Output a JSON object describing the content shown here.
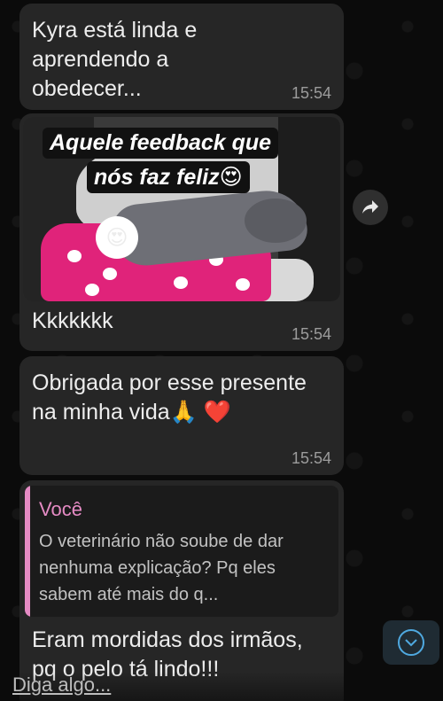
{
  "messages": [
    {
      "text": "Kyra está linda e aprendendo a obedecer...",
      "time": "15:54"
    },
    {
      "media_overlay_line1": "Aquele feedback que",
      "media_overlay_line2": "nós faz feliz😍",
      "sticker": "😍",
      "text": "Kkkkkkk",
      "time": "15:54"
    },
    {
      "text": "Obrigada por esse presente na minha vida🙏 ❤️",
      "time": "15:54"
    },
    {
      "quote_author": "Você",
      "quote_text": "O veterinário não soube de dar nenhuma explicação? Pq eles sabem até mais  do q...",
      "text": "Eram mordidas dos irmãos, pq o pelo tá lindo!!!"
    }
  ],
  "icons": {
    "forward": "forward-arrow-icon",
    "scroll_down": "chevron-down-icon"
  },
  "compose": {
    "placeholder": "Diga algo..."
  },
  "colors": {
    "bubble": "#262626",
    "quote_accent": "#e58bc4",
    "scroll_accent": "#4fa9e0"
  }
}
